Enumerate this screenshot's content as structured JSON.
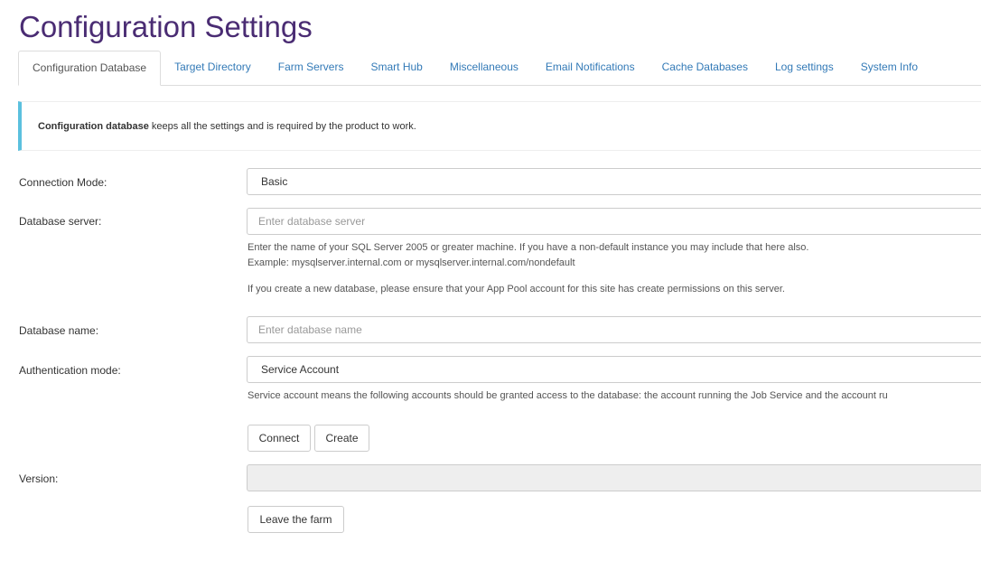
{
  "page": {
    "title": "Configuration Settings"
  },
  "tabs": [
    {
      "label": "Configuration Database",
      "active": true
    },
    {
      "label": "Target Directory"
    },
    {
      "label": "Farm Servers"
    },
    {
      "label": "Smart Hub"
    },
    {
      "label": "Miscellaneous"
    },
    {
      "label": "Email Notifications"
    },
    {
      "label": "Cache Databases"
    },
    {
      "label": "Log settings"
    },
    {
      "label": "System Info"
    }
  ],
  "callout": {
    "bold": "Configuration database",
    "text": " keeps all the settings and is required by the product to work."
  },
  "form": {
    "connection_mode": {
      "label": "Connection Mode:",
      "value": "Basic"
    },
    "database_server": {
      "label": "Database server:",
      "value": "",
      "placeholder": "Enter database server",
      "help1": "Enter the name of your SQL Server 2005 or greater machine. If you have a non-default instance you may include that here also.",
      "help2": "Example: mysqlserver.internal.com or mysqlserver.internal.com/nondefault",
      "help3": "If you create a new database, please ensure that your App Pool account for this site has create permissions on this server."
    },
    "database_name": {
      "label": "Database name:",
      "value": "",
      "placeholder": "Enter database name"
    },
    "authentication_mode": {
      "label": "Authentication mode:",
      "value": "Service Account",
      "help": "Service account means the following accounts should be granted access to the database: the account running the Job Service and the account ru"
    },
    "version": {
      "label": "Version:",
      "value": ""
    }
  },
  "buttons": {
    "connect": "Connect",
    "create": "Create",
    "leave_farm": "Leave the farm"
  },
  "colors": {
    "title": "#4a2c73",
    "link": "#337ab7",
    "callout_accent": "#5bc0de"
  }
}
